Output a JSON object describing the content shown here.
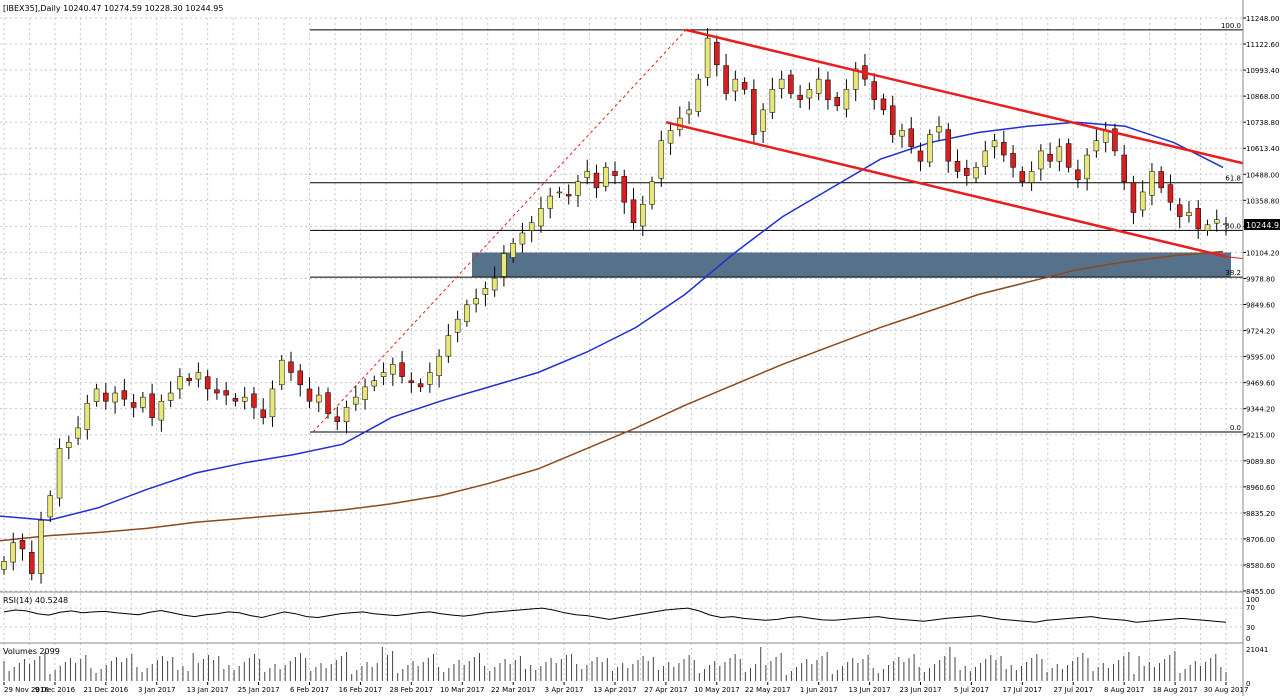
{
  "header": {
    "symbol": "IBEX35",
    "timeframe": "Daily",
    "ohlc": "10240.47 10274.59 10228.30 10244.95",
    "label": "[IBEX35],Daily  10240.47 10274.59 10228.30 10244.95"
  },
  "colors": {
    "background": "#ffffff",
    "grid": "#c8c8c8",
    "bull_candle": "#e8e87a",
    "bear_candle": "#d42020",
    "wick": "#000000",
    "ma_fast": "#1f2fd6",
    "ma_slow": "#8b4a1e",
    "channel": "#e81e1e",
    "zone": "#56728a",
    "fib_line": "#000000",
    "fib_dashed": "#e81e1e"
  },
  "chart_data": [
    {
      "type": "candlestick",
      "name": "IBEX35 Daily",
      "price_axis": {
        "ylim": [
          8455,
          11248
        ],
        "ticks": [
          "11248.00",
          "11122.60",
          "10993.40",
          "10868.00",
          "10738.80",
          "10613.40",
          "10488.00",
          "10358.80",
          "10233.40",
          "10104.20",
          "9978.80",
          "9849.60",
          "9724.20",
          "9595.00",
          "9469.60",
          "9344.20",
          "9215.00",
          "9089.80",
          "8960.60",
          "8835.20",
          "8706.00",
          "8580.60",
          "8455.00"
        ]
      },
      "date_axis": {
        "labels": [
          "29 Nov 2016",
          "9 Dec 2016",
          "21 Dec 2016",
          "3 Jan 2017",
          "13 Jan 2017",
          "25 Jan 2017",
          "6 Feb 2017",
          "16 Feb 2017",
          "28 Feb 2017",
          "10 Mar 2017",
          "22 Mar 2017",
          "3 Apr 2017",
          "13 Apr 2017",
          "27 Apr 2017",
          "10 May 2017",
          "22 May 2017",
          "1 Jun 2017",
          "13 Jun 2017",
          "23 Jun 2017",
          "5 Jul 2017",
          "17 Jul 2017",
          "27 Jul 2017",
          "8 Aug 2017",
          "18 Aug 2017",
          "30 Aug 2017"
        ]
      },
      "last_price_label": "10244.95",
      "closes": [
        8600,
        8690,
        8660,
        8540,
        8800,
        8920,
        9150,
        9180,
        9250,
        9370,
        9440,
        9380,
        9420,
        9390,
        9350,
        9400,
        9300,
        9380,
        9420,
        9500,
        9480,
        9520,
        9440,
        9420,
        9410,
        9380,
        9400,
        9350,
        9300,
        9440,
        9580,
        9520,
        9460,
        9380,
        9410,
        9320,
        9280,
        9350,
        9400,
        9450,
        9480,
        9520,
        9560,
        9500,
        9470,
        9450,
        9520,
        9600,
        9700,
        9780,
        9850,
        9880,
        9930,
        9980,
        10100,
        10150,
        10200,
        10250,
        10320,
        10380,
        10400,
        10380,
        10450,
        10500,
        10420,
        10520,
        10480,
        10350,
        10250,
        10340,
        10450,
        10650,
        10700,
        10760,
        10800,
        10950,
        11150,
        11020,
        10880,
        10950,
        10900,
        10680,
        10800,
        10900,
        10950,
        10880,
        10850,
        10900,
        10950,
        10850,
        10820,
        10900,
        11000,
        10950,
        10850,
        10800,
        10680,
        10700,
        10620,
        10550,
        10680,
        10720,
        10550,
        10500,
        10480,
        10520,
        10600,
        10650,
        10580,
        10520,
        10450,
        10500,
        10600,
        10550,
        10620,
        10520,
        10460,
        10580,
        10650,
        10700,
        10600,
        10450,
        10300,
        10400,
        10500,
        10420,
        10350,
        10280,
        10300,
        10220,
        10240,
        10265,
        10245
      ],
      "overlays": [
        {
          "name": "MA fast",
          "y_start": 8820,
          "y_end": 10520
        },
        {
          "name": "MA slow",
          "y_start": 8700,
          "y_end": 10110
        }
      ],
      "fibonacci": {
        "levels": [
          {
            "label": "100.0",
            "price": 11190
          },
          {
            "label": "61.8",
            "price": 10445
          },
          {
            "label": "50.0",
            "price": 10213
          },
          {
            "label": "38.2",
            "price": 9985
          },
          {
            "label": "0.0",
            "price": 9230
          }
        ]
      },
      "support_zone": {
        "from": 9985,
        "to": 10105
      },
      "channel": {
        "upper": [
          {
            "date": "27 Apr 2017",
            "price": 11190
          },
          {
            "date": "30 Aug 2017",
            "price": 10540
          }
        ],
        "lower": [
          {
            "date": "27 Apr 2017",
            "price": 10740
          },
          {
            "date": "30 Aug 2017",
            "price": 10085
          }
        ]
      }
    },
    {
      "type": "line",
      "name": "RSI(14)",
      "label": "RSI(14) 40.5248",
      "ylim": [
        0,
        100
      ],
      "ticks": [
        "100",
        "70",
        "30",
        "0"
      ],
      "values": [
        62,
        66,
        64,
        58,
        55,
        61,
        64,
        60,
        62,
        63,
        60,
        58,
        56,
        61,
        65,
        60,
        55,
        52,
        56,
        58,
        62,
        60,
        54,
        50,
        56,
        62,
        58,
        52,
        50,
        54,
        58,
        60,
        62,
        58,
        56,
        54,
        57,
        60,
        62,
        58,
        55,
        53,
        56,
        60,
        62,
        64,
        66,
        68,
        70,
        66,
        60,
        56,
        54,
        50,
        46,
        50,
        54,
        58,
        62,
        66,
        68,
        70,
        64,
        55,
        50,
        52,
        48,
        46,
        44,
        46,
        50,
        52,
        48,
        45,
        44,
        46,
        48,
        50,
        52,
        48,
        46,
        44,
        42,
        45,
        48,
        50,
        52,
        54,
        50,
        46,
        44,
        42,
        40,
        44,
        46,
        48,
        50,
        52,
        48,
        46,
        44,
        40,
        42,
        44,
        46,
        48,
        46,
        44,
        42,
        40
      ]
    },
    {
      "type": "bar",
      "name": "Volumes",
      "label": "Volumes 2099",
      "ylim": [
        0,
        21041
      ],
      "ticks": [
        "21041",
        "0"
      ]
    }
  ]
}
